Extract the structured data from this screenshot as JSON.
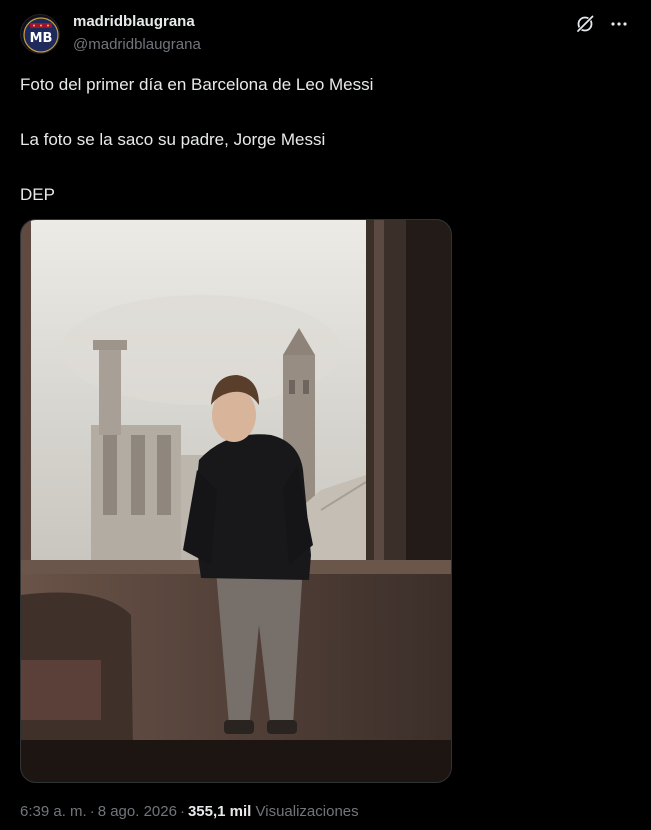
{
  "post": {
    "author": {
      "display_name": "madridblaugrana",
      "handle": "@madridblaugrana",
      "avatar_text": "MB"
    },
    "text_lines": [
      "Foto del primer día en Barcelona de Leo Messi",
      "La foto se la saco su padre, Jorge Messi",
      "DEP"
    ],
    "icons": {
      "grok": "grok-icon",
      "more": "more-options-icon"
    },
    "footer": {
      "time": "6:39 a. m.",
      "sep1": "·",
      "date": "8 ago. 2026",
      "sep2": "·",
      "views_count": "355,1 mil",
      "views_label": "Visualizaciones"
    }
  },
  "colors": {
    "background": "#000000",
    "text": "#e7e9ea",
    "secondary_text": "#71767b",
    "border": "#2f3336"
  }
}
